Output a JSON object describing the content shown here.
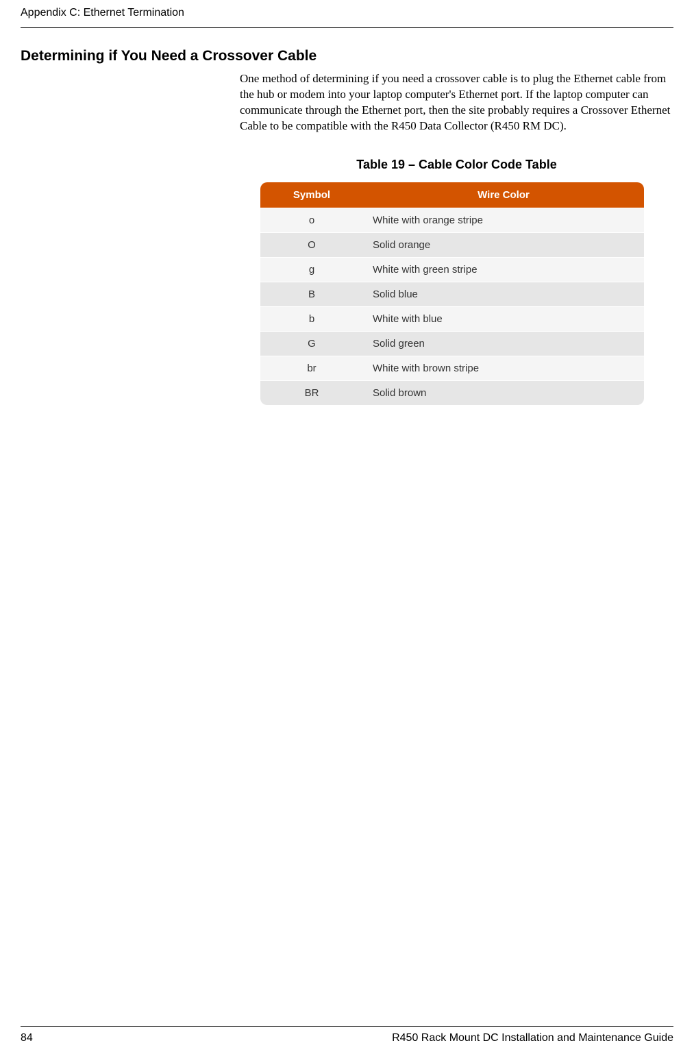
{
  "header": {
    "running_head": "Appendix C: Ethernet Termination"
  },
  "section": {
    "title": "Determining if You Need a Crossover Cable",
    "paragraph": "One method of determining if you need a crossover cable is to plug the Ethernet cable from the hub or modem into your laptop computer's Ethernet port. If the laptop computer can communicate through the Ethernet port, then the site probably requires a Crossover Ethernet Cable to be compatible with the R450 Data Collector (R450 RM DC)."
  },
  "table": {
    "caption": "Table 19  –  Cable Color Code Table",
    "columns": [
      "Symbol",
      "Wire Color"
    ],
    "rows": [
      {
        "symbol": "o",
        "color": "White with orange stripe"
      },
      {
        "symbol": "O",
        "color": "Solid orange"
      },
      {
        "symbol": "g",
        "color": "White with green stripe"
      },
      {
        "symbol": "B",
        "color": "Solid blue"
      },
      {
        "symbol": "b",
        "color": "White with blue"
      },
      {
        "symbol": "G",
        "color": "Solid green"
      },
      {
        "symbol": "br",
        "color": "White with brown stripe"
      },
      {
        "symbol": "BR",
        "color": "Solid brown"
      }
    ]
  },
  "footer": {
    "page_number": "84",
    "guide_title": "R450 Rack Mount DC Installation and Maintenance Guide"
  }
}
